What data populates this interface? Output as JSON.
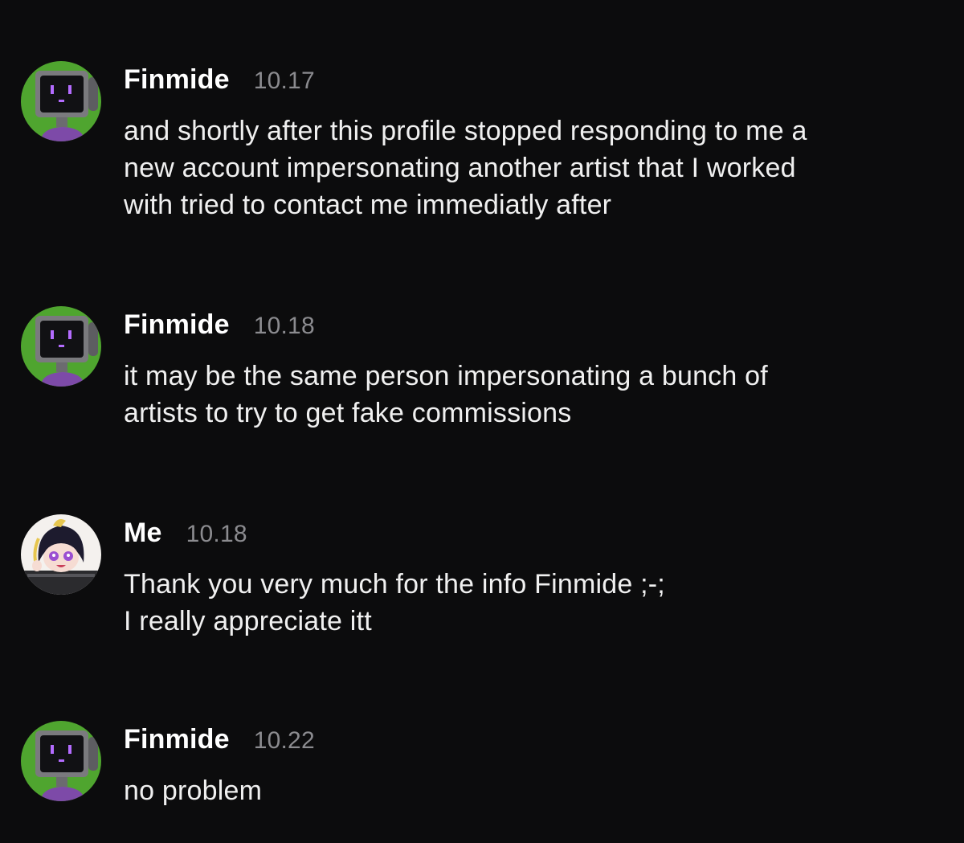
{
  "messages": [
    {
      "author": "Finmide",
      "time": "10.17",
      "avatar_icon": "monitor-head-avatar-icon",
      "lines": [
        "and shortly after this profile stopped responding to me a",
        "new account impersonating another artist that I worked",
        "with tried to contact me immediatly after"
      ]
    },
    {
      "author": "Finmide",
      "time": "10.18",
      "avatar_icon": "monitor-head-avatar-icon",
      "lines": [
        "it may be the same person impersonating a bunch of",
        "artists to try to get fake commissions"
      ]
    },
    {
      "author": "Me",
      "time": "10.18",
      "avatar_icon": "anime-character-avatar-icon",
      "lines": [
        "Thank you very much for the info Finmide ;-;",
        "I really appreciate itt"
      ]
    },
    {
      "author": "Finmide",
      "time": "10.22",
      "avatar_icon": "monitor-head-avatar-icon",
      "lines": [
        "no problem"
      ]
    }
  ],
  "colors": {
    "background": "#0c0c0d",
    "text": "#f0f0f0",
    "timestamp": "#8b8b8f",
    "avatar_green": "#4fa52f",
    "avatar_purple": "#7d4aa8"
  }
}
